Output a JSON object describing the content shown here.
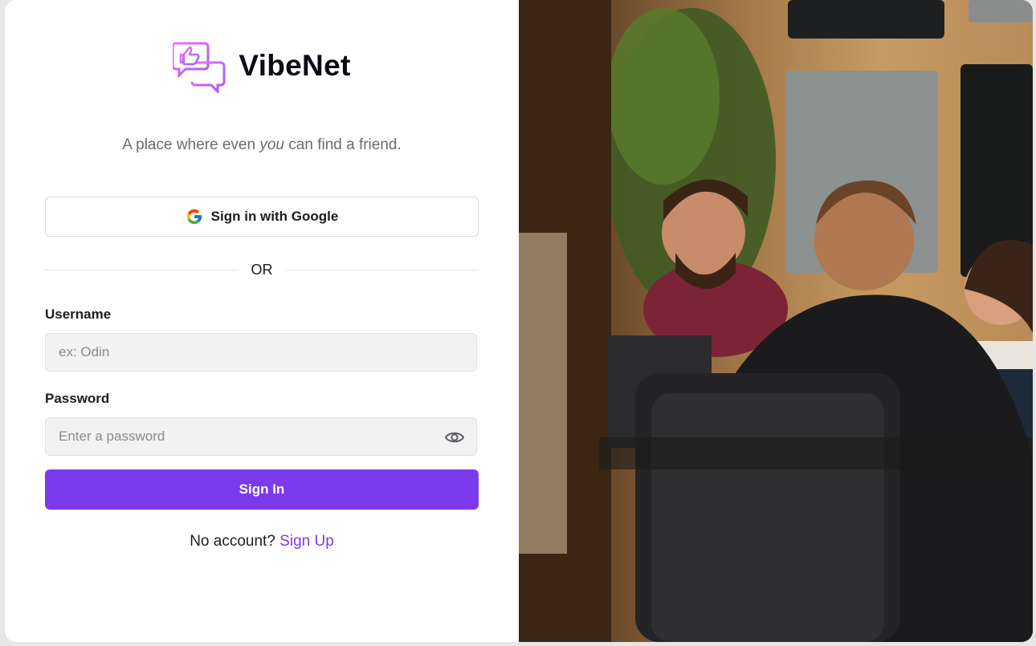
{
  "brand": {
    "name": "VibeNet",
    "logo_icon": "chat-bubbles-thumbs-up-icon",
    "logo_colors": [
      "#e879f9",
      "#a855f7"
    ]
  },
  "tagline": {
    "before": "A place where even ",
    "emphasis": "you",
    "after": " can find a friend."
  },
  "google_button": {
    "label": "Sign in with Google",
    "icon": "google-icon"
  },
  "divider_text": "OR",
  "username": {
    "label": "Username",
    "placeholder": "ex: Odin",
    "value": ""
  },
  "password": {
    "label": "Password",
    "placeholder": "Enter a password",
    "value": "",
    "toggle_icon": "eye-icon"
  },
  "submit": {
    "label": "Sign In"
  },
  "signup": {
    "prompt": "No account? ",
    "link_label": "Sign Up"
  },
  "hero_image": {
    "subject": "office-coworkers-photo"
  },
  "colors": {
    "accent": "#7c3aed",
    "input_bg": "#f2f2f3",
    "text": "#1c1c22",
    "muted": "#6b6b72"
  }
}
